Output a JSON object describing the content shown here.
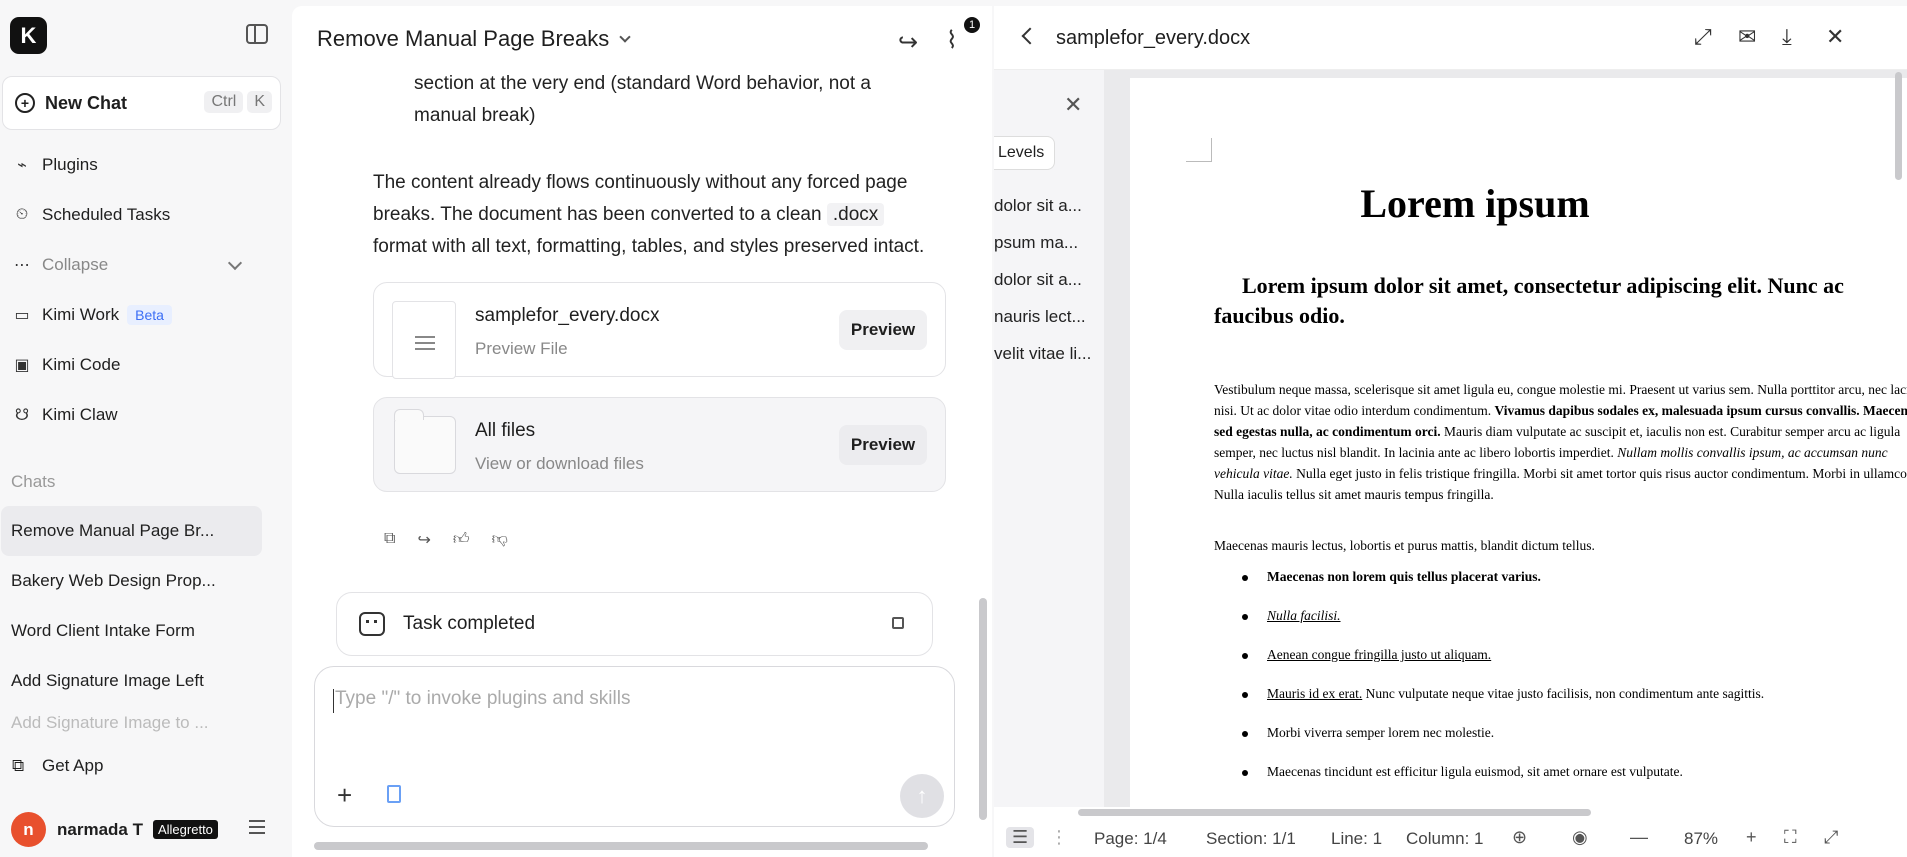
{
  "app": {
    "logo_letter": "K"
  },
  "sidebar": {
    "new_chat": "New Chat",
    "shortcut": [
      "Ctrl",
      "K"
    ],
    "nav": [
      {
        "label": "Plugins",
        "icon": "plug-icon"
      },
      {
        "label": "Scheduled Tasks",
        "icon": "clock-icon"
      },
      {
        "label": "Collapse",
        "icon": "dots-icon"
      },
      {
        "label": "Kimi Work",
        "icon": "monitor-icon",
        "badge": "Beta"
      },
      {
        "label": "Kimi Code",
        "icon": "terminal-icon"
      },
      {
        "label": "Kimi Claw",
        "icon": "claw-icon"
      }
    ],
    "chats_label": "Chats",
    "chats": [
      "Remove Manual Page Br...",
      "Bakery Web Design Prop...",
      "Word Client Intake Form",
      "Add Signature Image Left",
      "Add Signature Image to ..."
    ],
    "get_app": "Get App",
    "user": {
      "initial": "n",
      "name": "narmada T",
      "plan": "Allegretto"
    }
  },
  "chat": {
    "title": "Remove Manual Page Breaks",
    "attachment_count": "1",
    "msg_top": [
      "section at the very end (standard Word behavior, not a",
      "manual break)"
    ],
    "msg_main_1": "The content already flows continuously without any forced page",
    "msg_main_2": "breaks. The document has been converted to a clean",
    "msg_main_code": ".docx",
    "msg_main_3": "format with all text, formatting, tables, and styles preserved intact.",
    "file_card": {
      "name": "samplefor_every.docx",
      "sub": "Preview File",
      "button": "Preview"
    },
    "all_files_card": {
      "name": "All files",
      "sub": "View or download files",
      "button": "Preview"
    },
    "task": "Task completed",
    "input_placeholder": "Type \"/\" to invoke plugins and skills"
  },
  "doc": {
    "filename": "samplefor_every.docx",
    "levels": "Levels",
    "outline": [
      "dolor sit a...",
      "psum ma...",
      "dolor sit a...",
      "nauris lect...",
      "velit vitae li..."
    ],
    "h1": "Lorem ipsum",
    "h2": "Lorem ipsum dolor sit amet, consectetur adipiscing elit. Nunc ac faucibus odio.",
    "para_a": "Vestibulum neque massa, scelerisque sit amet ligula eu, congue molestie mi. Praesent ut varius sem. Nulla porttitor arcu, nec lacinia nisi. Ut ac dolor vitae odio interdum condimentum. ",
    "para_b": "Vivamus dapibus sodales ex, malesuada ipsum cursus convallis. Maecenas sed egestas nulla, ac condimentum orci.",
    "para_c": " Mauris diam vulputate ac suscipit et, iaculis non est. Curabitur semper arcu ac ligula semper, nec luctus nisl blandit. In lacinia ante ac libero lobortis imperdiet. ",
    "para_d": "Nullam mollis convallis ipsum, ac accumsan nunc vehicula vitae.",
    "para_e": " Nulla eget justo in felis tristique fringilla. Morbi sit amet tortor quis risus auctor condimentum. Morbi in ullamco elit. Nulla iaculis tellus sit amet mauris tempus fringilla.",
    "para2": "Maecenas mauris lectus, lobortis et purus mattis, blandit dictum tellus.",
    "bullets": [
      "Maecenas non lorem quis tellus placerat varius.",
      "Nulla facilisi.",
      "Aenean congue fringilla justo ut aliquam.",
      "Mauris id ex erat.",
      "Morbi viverra semper lorem nec molestie.",
      "Maecenas tincidunt est efficitur ligula euismod, sit amet ornare est vulputate."
    ],
    "bullet4_rest": " Nunc vulputate neque vitae justo facilisis, non condimentum ante sagittis.",
    "status": {
      "page": "Page: 1/4",
      "section": "Section: 1/1",
      "line": "Line: 1",
      "column": "Column: 1",
      "zoom": "87%"
    }
  }
}
